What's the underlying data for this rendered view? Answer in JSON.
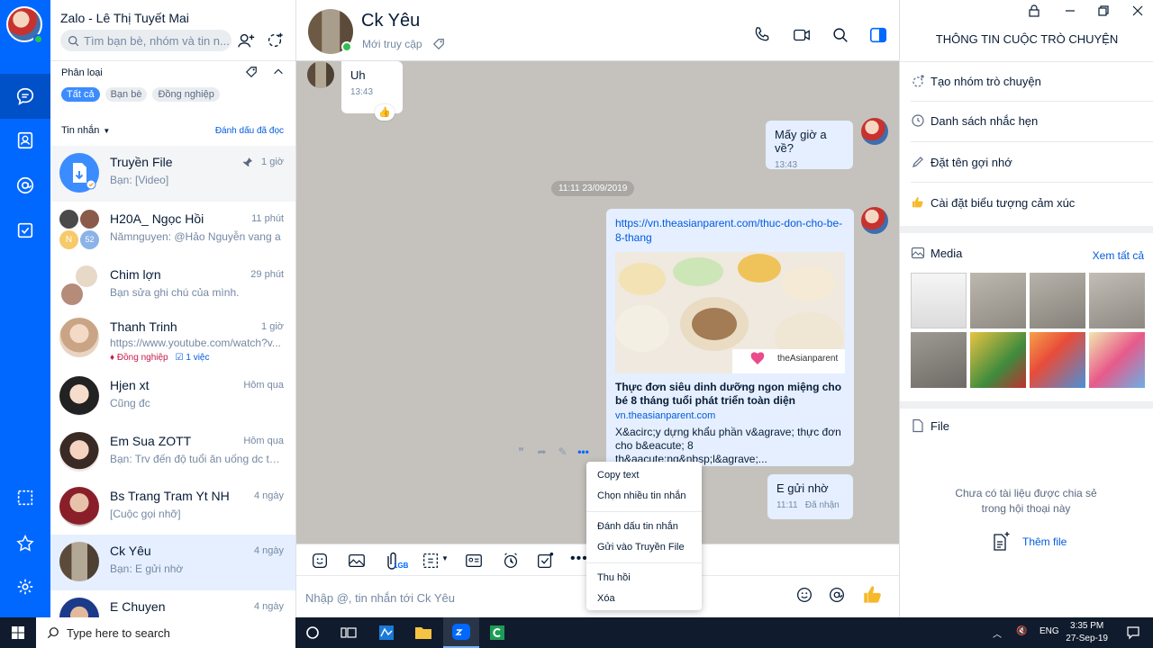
{
  "app": {
    "title": "Zalo - Lê Thị Tuyết Mai",
    "search_placeholder": "Tìm bạn bè, nhóm và tin n..."
  },
  "sidebar": {
    "classify_label": "Phân loại",
    "chips": [
      "Tất cả",
      "Bạn bè",
      "Đồng nghiệp"
    ],
    "filter_label": "Tin nhắn",
    "mark_read": "Đánh dấu đã đọc",
    "conversations": [
      {
        "name": "Truyền File",
        "time": "1 giờ",
        "preview": "Bạn: [Video]"
      },
      {
        "name": "H20A_ Ngọc Hồi",
        "time": "11 phút",
        "preview": "Nămnguyen: @Hảo Nguyễn vang a",
        "badge": "52",
        "initial": "N"
      },
      {
        "name": "Chim lợn",
        "time": "29 phút",
        "preview": "Bạn sửa ghi chú của mình."
      },
      {
        "name": "Thanh Trinh",
        "time": "1 giờ",
        "preview": "https://www.youtube.com/watch?v...",
        "tag1": "Đồng nghiệp",
        "tag2": "1 việc"
      },
      {
        "name": "Hjen xt",
        "time": "Hôm qua",
        "preview": "Cũng đc"
      },
      {
        "name": "Em Sua ZOTT",
        "time": "Hôm qua",
        "preview": "Bạn: Trv đến độ tuổi ăn uống dc tự..."
      },
      {
        "name": "Bs Trang Tram Yt NH",
        "time": "4 ngày",
        "preview": "[Cuộc gọi nhỡ]"
      },
      {
        "name": "Ck Yêu",
        "time": "4 ngày",
        "preview": "Bạn: E gửi nhờ"
      },
      {
        "name": "E Chuyen",
        "time": "4 ngày",
        "preview": ""
      }
    ]
  },
  "chat": {
    "contact": "Ck Yêu",
    "status": "Mới truy cập",
    "messages": {
      "m1_text": "Uh",
      "m1_time": "13:43",
      "m2_text": "Mấy giờ a về?",
      "m2_time": "13:43",
      "date_chip": "11:11 23/09/2019",
      "link_url": "https://vn.theasianparent.com/thuc-don-cho-be-8-thang",
      "link_title": "Thực đơn siêu dinh dưỡng ngon miệng cho bé 8 tháng tuổi phát triển toàn diện",
      "link_domain": "vn.theasianparent.com",
      "link_desc": "X&acirc;y dựng khẩu phần v&agrave; thực đơn cho b&eacute; 8 th&aacute;ng&nbsp;l&agrave;...",
      "link_brand": "theAsianparent",
      "m3_text": "E gửi nhờ",
      "m3_time": "11:11",
      "m3_status": "Đã nhận"
    },
    "context_menu": [
      "Copy text",
      "Chọn nhiều tin nhắn",
      "Đánh dấu tin nhắn",
      "Gửi vào Truyền File",
      "Thu hồi",
      "Xóa"
    ],
    "composer_placeholder": "Nhập @, tin nhắn tới Ck Yêu",
    "attach_size": "1GB"
  },
  "info": {
    "title": "THÔNG TIN CUỘC TRÒ CHUYỆN",
    "actions": [
      "Tạo nhóm trò chuyện",
      "Danh sách nhắc hẹn",
      "Đặt tên gợi nhớ",
      "Cài đặt biểu tượng cảm xúc"
    ],
    "media_label": "Media",
    "see_all": "Xem tất cả",
    "file_label": "File",
    "no_file": "Chưa có tài liệu được chia sẻ trong hội thoại này",
    "add_file": "Thêm file"
  },
  "taskbar": {
    "search_placeholder": "Type here to search",
    "lang": "ENG",
    "time": "3:35 PM",
    "date": "27-Sep-19"
  },
  "colors": {
    "brand": "#0068ff",
    "link": "#005ae0",
    "online": "#30c04f"
  }
}
